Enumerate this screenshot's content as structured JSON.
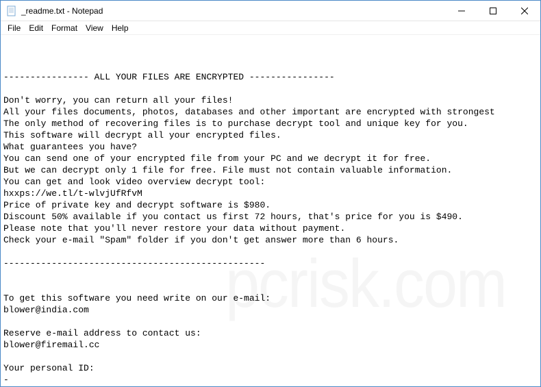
{
  "window": {
    "title": "_readme.txt - Notepad"
  },
  "menu": {
    "file": "File",
    "edit": "Edit",
    "format": "Format",
    "view": "View",
    "help": "Help"
  },
  "content": {
    "lines": [
      "---------------- ALL YOUR FILES ARE ENCRYPTED ----------------",
      "",
      "Don't worry, you can return all your files!",
      "All your files documents, photos, databases and other important are encrypted with strongest",
      "The only method of recovering files is to purchase decrypt tool and unique key for you.",
      "This software will decrypt all your encrypted files.",
      "What guarantees you have?",
      "You can send one of your encrypted file from your PC and we decrypt it for free.",
      "But we can decrypt only 1 file for free. File must not contain valuable information.",
      "You can get and look video overview decrypt tool:",
      "hxxps://we.tl/t-wlvjUfRfvM",
      "Price of private key and decrypt software is $980.",
      "Discount 50% available if you contact us first 72 hours, that's price for you is $490.",
      "Please note that you'll never restore your data without payment.",
      "Check your e-mail \"Spam\" folder if you don't get answer more than 6 hours.",
      "",
      "-------------------------------------------------",
      "",
      "",
      "To get this software you need write on our e-mail:",
      "blower@india.com",
      "",
      "Reserve e-mail address to contact us:",
      "blower@firemail.cc",
      "",
      "Your personal ID:",
      "-"
    ]
  },
  "watermark": "pcrisk.com"
}
